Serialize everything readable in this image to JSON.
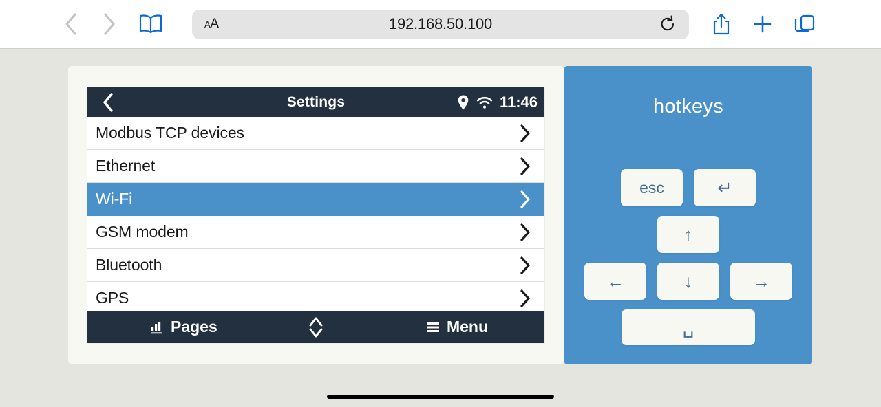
{
  "browser": {
    "back_icon": "chevron-left-icon",
    "forward_icon": "chevron-right-icon",
    "bookmarks_icon": "book-icon",
    "text_size_small": "A",
    "text_size_large": "A",
    "url": "192.168.50.100",
    "reload_icon": "reload-icon",
    "share_icon": "share-icon",
    "new_tab_icon": "plus-icon",
    "tabs_icon": "tabs-icon",
    "accent_color": "#0b68da",
    "disabled_color": "#c3c3c3"
  },
  "device": {
    "header": {
      "back_label": "‹",
      "title": "Settings",
      "location_icon": "location-pin-icon",
      "wifi_icon": "wifi-icon",
      "time": "11:46",
      "bg_color": "#23303f"
    },
    "rows": [
      {
        "label": "Modbus TCP devices",
        "selected": false
      },
      {
        "label": "Ethernet",
        "selected": false
      },
      {
        "label": "Wi-Fi",
        "selected": true
      },
      {
        "label": "GSM modem",
        "selected": false
      },
      {
        "label": "Bluetooth",
        "selected": false
      },
      {
        "label": "GPS",
        "selected": false
      }
    ],
    "footer": {
      "pages_label": "Pages",
      "pages_icon": "bar-chart-icon",
      "updown_icon": "up-down-chevron-icon",
      "menu_label": "Menu",
      "menu_icon": "hamburger-icon"
    },
    "selected_color": "#4a90c9"
  },
  "hotkeys": {
    "title": "hotkeys",
    "panel_color": "#4a90c9",
    "keys": [
      {
        "name": "esc-key",
        "label": "esc",
        "icon": null,
        "wide": false
      },
      {
        "name": "return-key",
        "label": "↵",
        "icon": "return-icon",
        "wide": false
      },
      {
        "name": "arrow-up-key",
        "label": "↑",
        "icon": "arrow-up-icon",
        "wide": false
      },
      {
        "name": "arrow-left-key",
        "label": "←",
        "icon": "arrow-left-icon",
        "wide": false
      },
      {
        "name": "arrow-down-key",
        "label": "↓",
        "icon": "arrow-down-icon",
        "wide": false
      },
      {
        "name": "arrow-right-key",
        "label": "→",
        "icon": "arrow-right-icon",
        "wide": false
      },
      {
        "name": "space-key",
        "label": "␣",
        "icon": "space-icon",
        "wide": true
      }
    ]
  }
}
